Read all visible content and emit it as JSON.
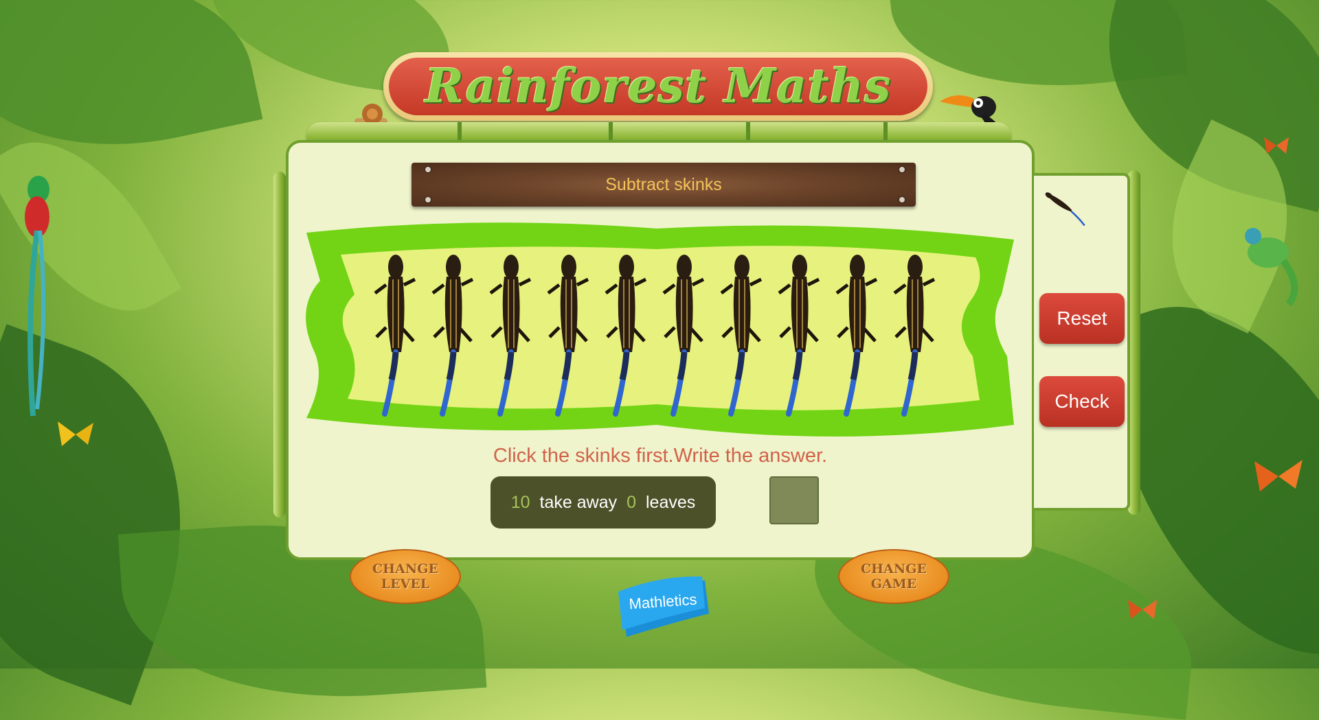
{
  "title": "Rainforest Maths",
  "task_title": "Subtract skinks",
  "instruction": "Click the skinks first.Write the answer.",
  "equation": {
    "start": "10",
    "take_away_label": "take away",
    "removed": "0",
    "leaves_label": "leaves",
    "answer": ""
  },
  "skinks": {
    "count": 10,
    "removed": 0
  },
  "buttons": {
    "reset": "Reset",
    "check": "Check",
    "change_level": [
      "CHANGE",
      "LEVEL"
    ],
    "change_game": [
      "CHANGE",
      "GAME"
    ]
  },
  "brand": "Mathletics",
  "icons": [
    "skink-icon",
    "toucan-icon",
    "snail-icon",
    "quetzal-bird-icon",
    "butterfly-icon",
    "chameleon-icon"
  ],
  "colors": {
    "panel": "#eff4cd",
    "field_border": "#72d414",
    "field_fill": "#e6f27d",
    "instruction": "#d0624a",
    "button_red": "#c93a2b",
    "oval_orange": "#ee9a2e"
  }
}
